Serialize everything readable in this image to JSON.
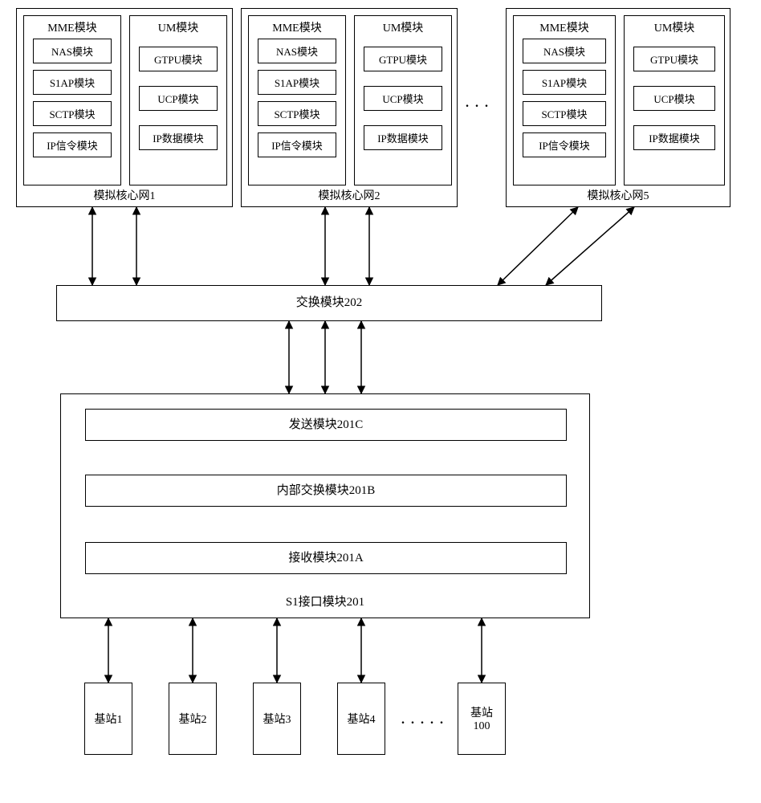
{
  "core_nets": [
    {
      "label": "模拟核心网1",
      "mme": {
        "title": "MME模块",
        "items": [
          "NAS模块",
          "S1AP模块",
          "SCTP模块",
          "IP信令模块"
        ]
      },
      "um": {
        "title": "UM模块",
        "items": [
          "GTPU模块",
          "UCP模块",
          "IP数据模块"
        ]
      }
    },
    {
      "label": "模拟核心网2",
      "mme": {
        "title": "MME模块",
        "items": [
          "NAS模块",
          "S1AP模块",
          "SCTP模块",
          "IP信令模块"
        ]
      },
      "um": {
        "title": "UM模块",
        "items": [
          "GTPU模块",
          "UCP模块",
          "IP数据模块"
        ]
      }
    },
    {
      "label": "模拟核心网5",
      "mme": {
        "title": "MME模块",
        "items": [
          "NAS模块",
          "S1AP模块",
          "SCTP模块",
          "IP信令模块"
        ]
      },
      "um": {
        "title": "UM模块",
        "items": [
          "GTPU模块",
          "UCP模块",
          "IP数据模块"
        ]
      }
    }
  ],
  "exchange": {
    "label": "交换模块202"
  },
  "s1": {
    "outer_label": "S1接口模块201",
    "inner": [
      {
        "label": "发送模块201C"
      },
      {
        "label": "内部交换模块201B"
      },
      {
        "label": "接收模块201A"
      }
    ]
  },
  "base_stations": [
    "基站1",
    "基站2",
    "基站3",
    "基站4",
    "基站\n100"
  ],
  "ellipsis": ". . . . ."
}
